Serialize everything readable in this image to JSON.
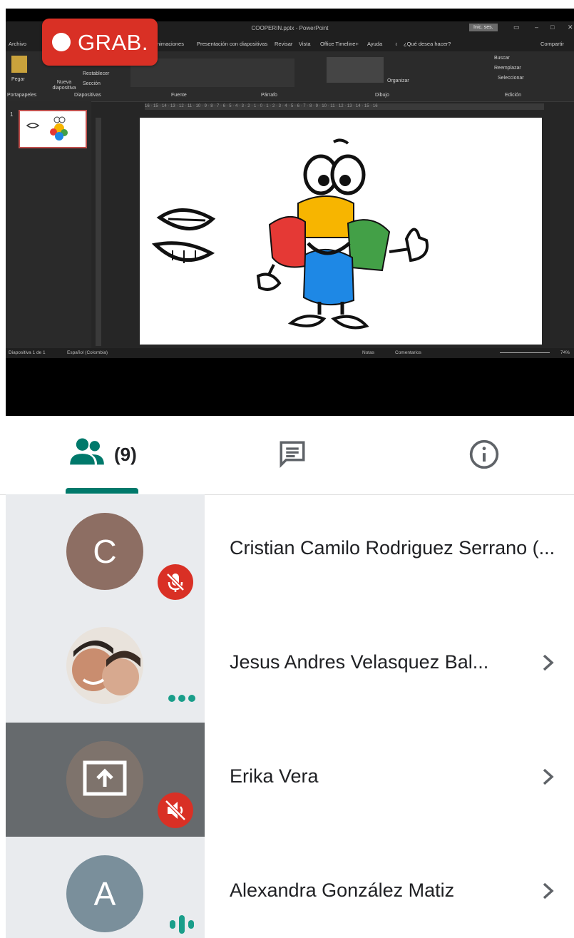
{
  "powerpoint": {
    "title": "COOPERIN.pptx - PowerPoint",
    "login_button": "Inic. ses.",
    "menu_file": "Archivo",
    "menu": [
      "Animaciones",
      "Presentación con diapositivas",
      "Revisar",
      "Vista",
      "Office Timeline+",
      "Ayuda"
    ],
    "tell_me": "¿Qué desea hacer?",
    "share": "Compartir",
    "ribbon": {
      "paste": "Pegar",
      "new_slide": "Nueva diapositiva",
      "reset": "Restablecer",
      "section": "Sección",
      "groups": [
        "Portapapeles",
        "Diapositivas",
        "Fuente",
        "Párrafo",
        "Dibujo",
        "Edición"
      ],
      "arrange": "Organizar",
      "find": "Buscar",
      "replace": "Reemplazar",
      "select": "Seleccionar"
    },
    "ruler": "16 · 15 · 14 · 13 · 12 · 11 · 10 · 9 · 8 · 7 · 6 · 5 · 4 · 3 · 2 · 1 · 0 · 1 · 2 · 3 · 4 · 5 · 6 · 7 · 8 · 9 · 10 · 11 · 12 · 13 · 14 · 15 · 16",
    "thumb_number": "1",
    "status": {
      "slide": "Diapositiva 1 de 1",
      "language": "Español (Colombia)",
      "notes": "Notas",
      "comments": "Comentarios",
      "zoom": "74%"
    }
  },
  "recording": {
    "label": "GRAB."
  },
  "tabs": {
    "people_count": "(9)",
    "people_icon": "people-icon",
    "chat_icon": "chat-icon",
    "info_icon": "info-icon",
    "active": "people"
  },
  "participants": [
    {
      "name": "Cristian Camilo Rodriguez Serrano (...",
      "initial": "C",
      "avatar_color": "#8d6e63",
      "status": "muted",
      "chevron": false
    },
    {
      "name": "Jesus Andres Velasquez Bal...",
      "initial": "",
      "avatar_color": "#d9a98c",
      "status": "more",
      "chevron": true
    },
    {
      "name": "Erika Vera",
      "initial": "",
      "avatar_color": "#8a7b72",
      "status": "presenting-muted",
      "chevron": true
    },
    {
      "name": "Alexandra González Matiz",
      "initial": "A",
      "avatar_color": "#7a8f9b",
      "status": "speaking",
      "chevron": true
    }
  ],
  "colors": {
    "accent": "#00796b",
    "record_red": "#d93025",
    "speaking_teal": "#1a9e8a"
  }
}
